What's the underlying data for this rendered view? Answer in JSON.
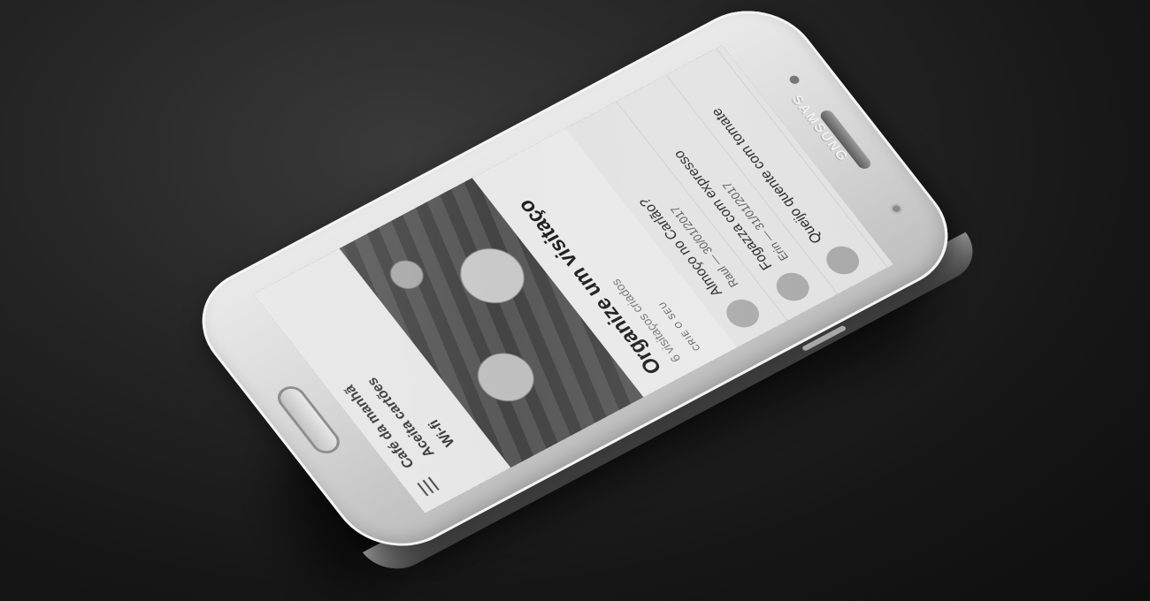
{
  "device": {
    "brand": "SAMSUNG"
  },
  "app": {
    "tags": [
      "Café da manhã",
      "Aceita cartões",
      "Wi-fi"
    ],
    "card": {
      "title": "Organize um visitaço",
      "subtitle": "6 visitaços criados",
      "cta": "CRIE O SEU"
    },
    "list": [
      {
        "title": "Almoço no Carlão?",
        "meta": "Raul — 30/01/2017"
      },
      {
        "title": "Fogazza com expresso",
        "meta": "Erin — 31/01/2017"
      },
      {
        "title": "Queijo quente com tomate",
        "meta": ""
      }
    ]
  }
}
